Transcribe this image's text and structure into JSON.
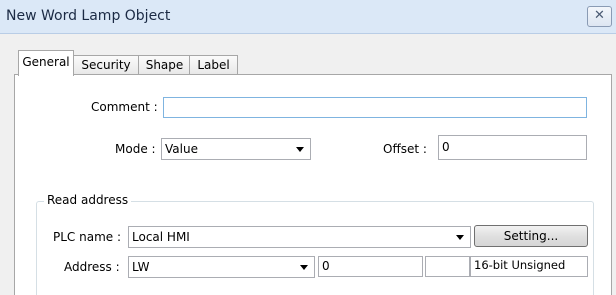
{
  "window": {
    "title": "New Word Lamp Object",
    "close_glyph": "✕"
  },
  "tabs": [
    "General",
    "Security",
    "Shape",
    "Label"
  ],
  "active_tab": "General",
  "form": {
    "comment_label": "Comment :",
    "comment_value": "",
    "mode_label": "Mode :",
    "mode_value": "Value",
    "offset_label": "Offset :",
    "offset_value": "0"
  },
  "read_address": {
    "group_title": "Read address",
    "plc_name_label": "PLC name :",
    "plc_name_value": "Local HMI",
    "setting_button": "Setting...",
    "address_label": "Address :",
    "address_type": "LW",
    "address_value": "0",
    "address_extra": "",
    "data_format": "16-bit Unsigned"
  },
  "icons": {
    "close": "close-icon",
    "dropdown": "chevron-down-icon"
  },
  "colors": {
    "titlebar": "#dbe8f7",
    "dialog_bg": "#f0f0f0",
    "panel_bg": "#ffffff",
    "focus_border": "#7fb4e0"
  }
}
